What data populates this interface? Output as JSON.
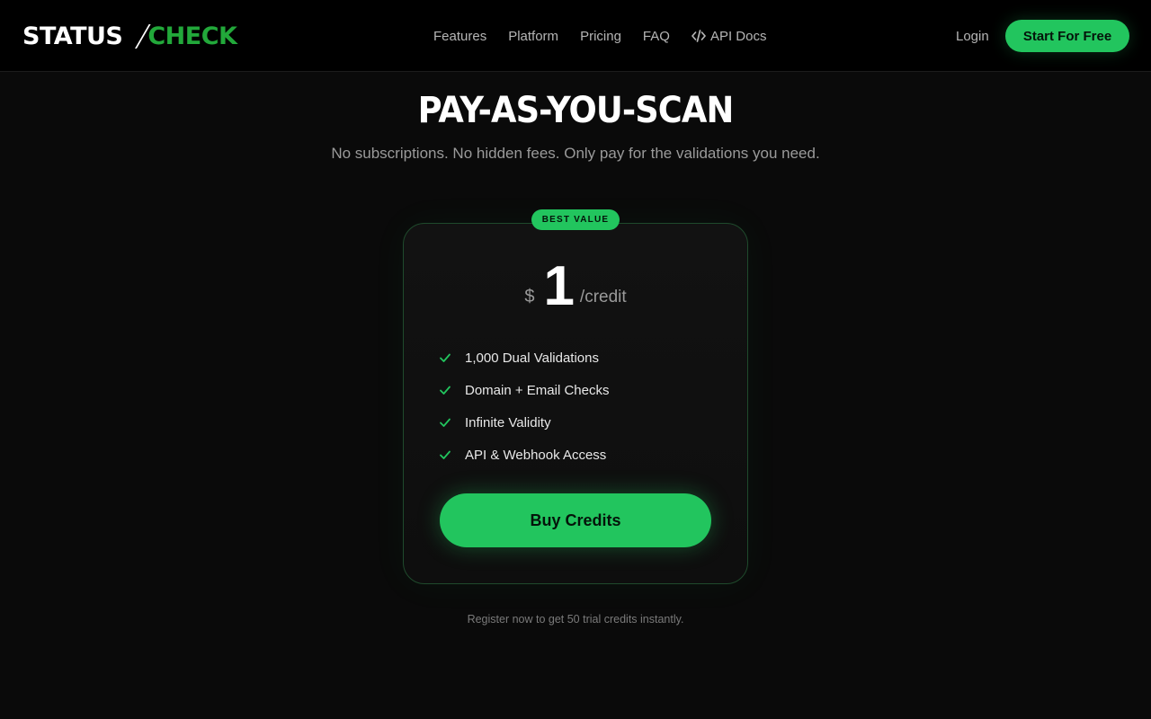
{
  "brand": {
    "part1": "STATUS",
    "part2": "CHECK",
    "accent_color": "#22a83a"
  },
  "nav": {
    "items": [
      {
        "label": "Features"
      },
      {
        "label": "Platform"
      },
      {
        "label": "Pricing"
      },
      {
        "label": "FAQ"
      },
      {
        "label": "API Docs",
        "icon": "code-icon"
      }
    ],
    "login_label": "Login",
    "cta_label": "Start For Free"
  },
  "hero": {
    "title": "PAY-AS-YOU-SCAN",
    "subtitle": "No subscriptions. No hidden fees. Only pay for the validations you need."
  },
  "plan": {
    "badge": "BEST VALUE",
    "currency": "$",
    "amount": "1",
    "unit": "/credit",
    "features": [
      "1,000 Dual Validations",
      "Domain + Email Checks",
      "Infinite Validity",
      "API & Webhook Access"
    ],
    "feature_icon": "check-icon",
    "button_label": "Buy Credits"
  },
  "footer_note": "Register now to get 50 trial credits instantly.",
  "colors": {
    "background": "#0a0a0a",
    "header": "#000000",
    "primary": "#22c55e"
  }
}
